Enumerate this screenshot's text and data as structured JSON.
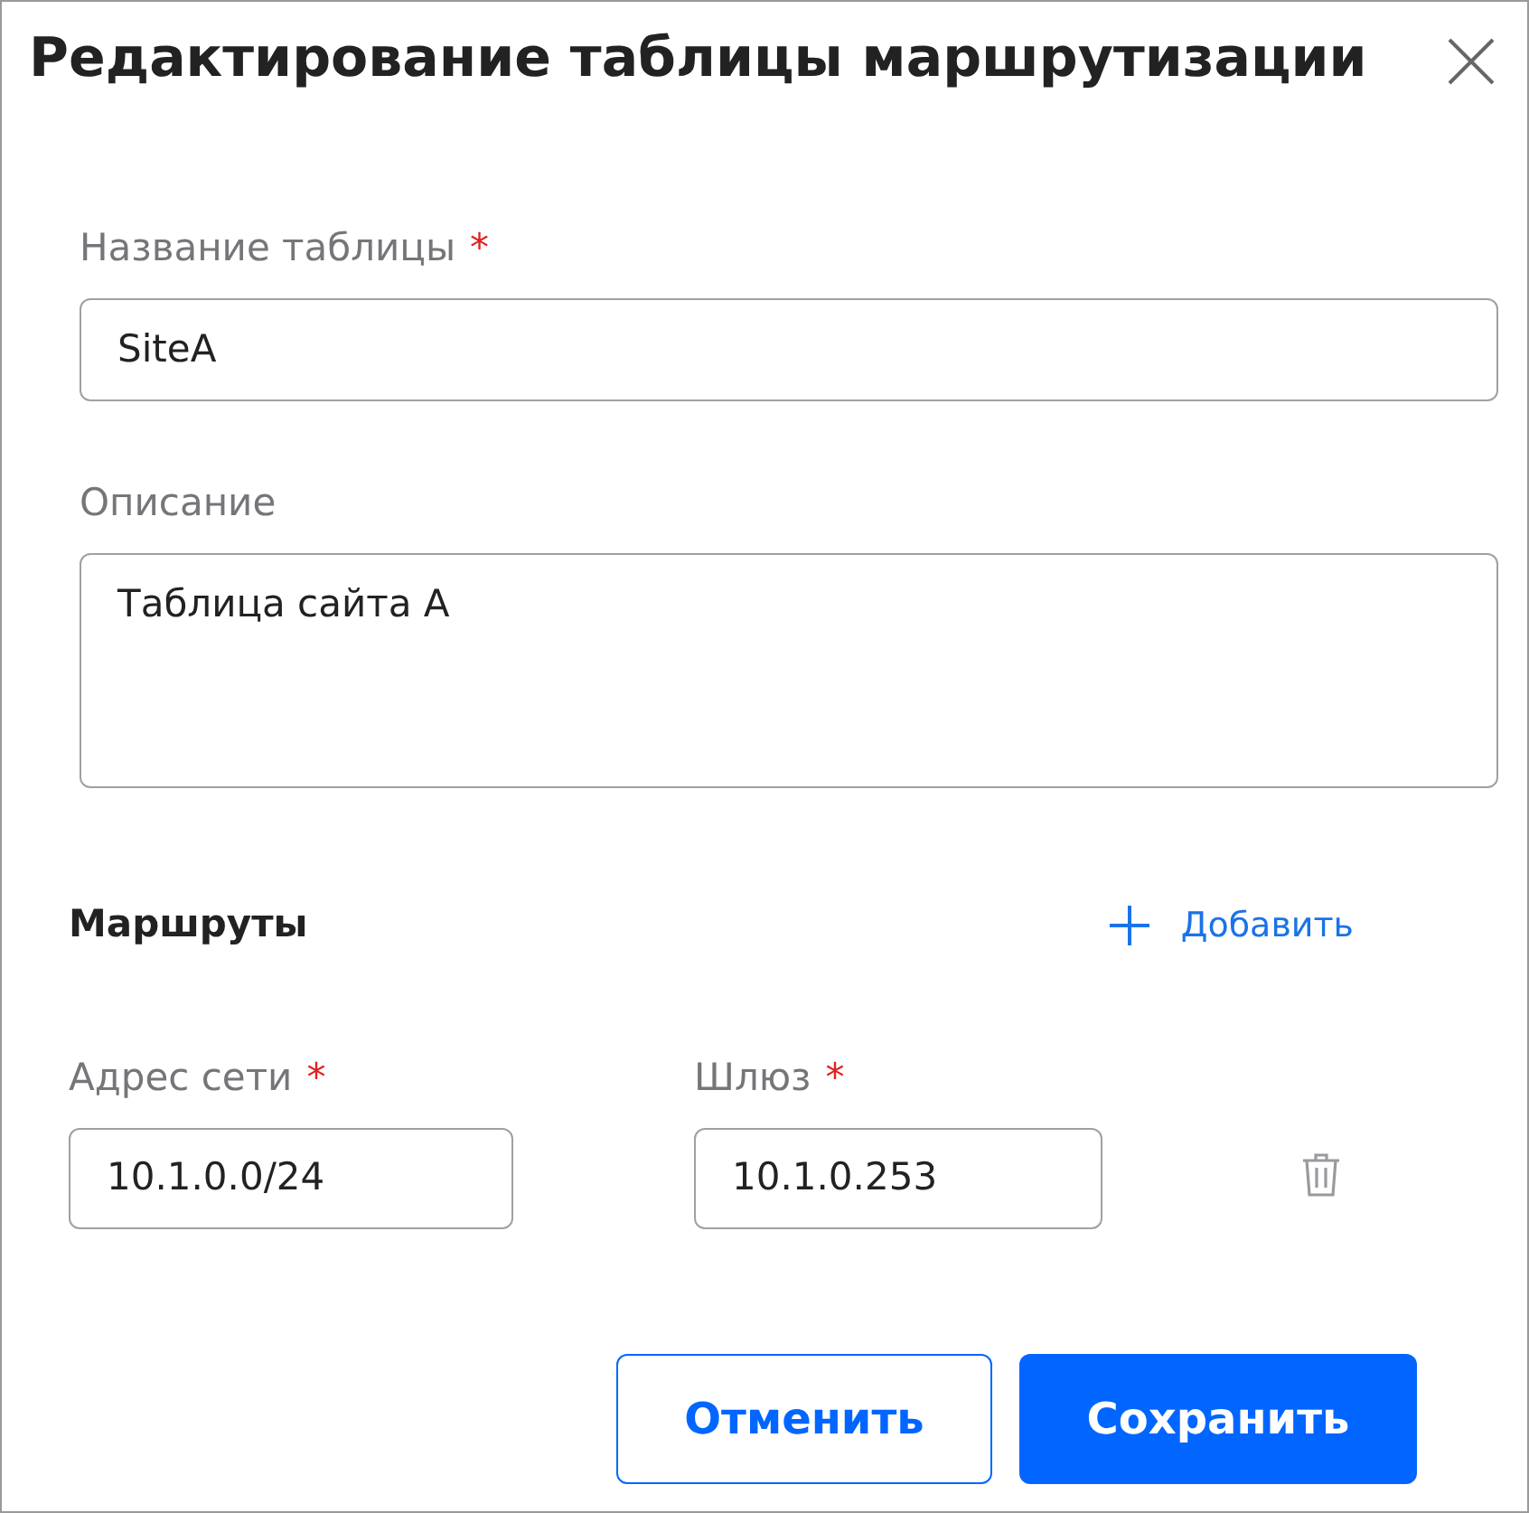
{
  "dialog": {
    "title": "Редактирование таблицы маршрутизации"
  },
  "required_mark": "*",
  "fields": [
    {
      "kind": "input",
      "label": "Название таблицы",
      "required": true,
      "value": "SiteA"
    },
    {
      "kind": "textarea",
      "label": "Описание",
      "required": false,
      "value": "Таблица сайта А"
    }
  ],
  "routes": {
    "title": "Маршруты",
    "add_label": "Добавить",
    "rows": [
      {
        "network": {
          "label": "Адрес сети",
          "required": true,
          "value": "10.1.0.0/24"
        },
        "gateway": {
          "label": "Шлюз",
          "required": true,
          "value": "10.1.0.253"
        }
      }
    ]
  },
  "buttons": [
    {
      "kind": "secondary",
      "label": "Отменить"
    },
    {
      "kind": "primary",
      "label": "Сохранить"
    }
  ]
}
